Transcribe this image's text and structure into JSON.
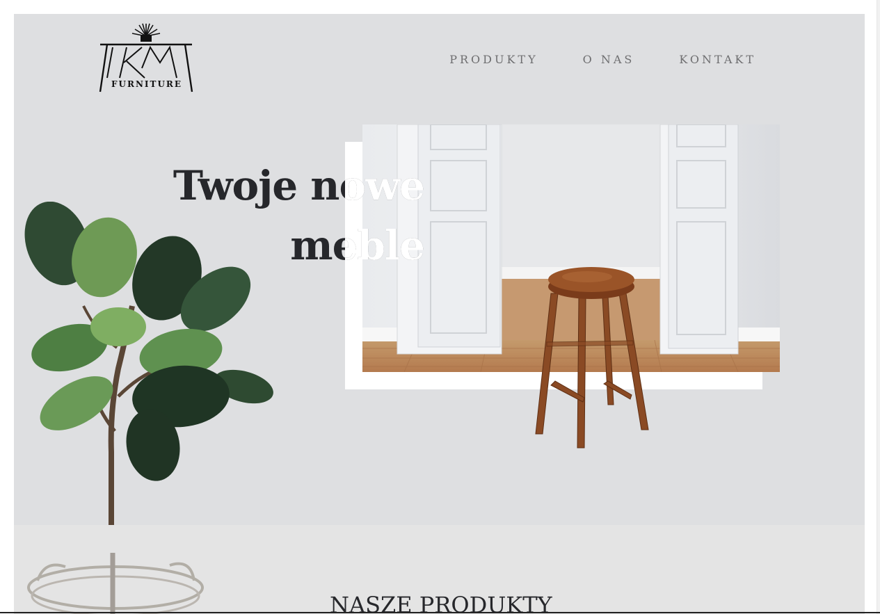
{
  "brand": {
    "logo_letters": "TKMT",
    "logo_word": "FURNITURE"
  },
  "nav": {
    "items": [
      {
        "label": "PRODUKTY"
      },
      {
        "label": "O NAS"
      },
      {
        "label": "KONTAKT"
      }
    ]
  },
  "hero": {
    "headline": "Twoje nowe meble"
  },
  "products_section": {
    "title": "NASZE PRODUKTY"
  },
  "colors": {
    "hero_bg": "#dedfe1",
    "section_bg": "#e4e4e4",
    "text_dark": "#26272b",
    "nav_text": "#6e6e70"
  }
}
